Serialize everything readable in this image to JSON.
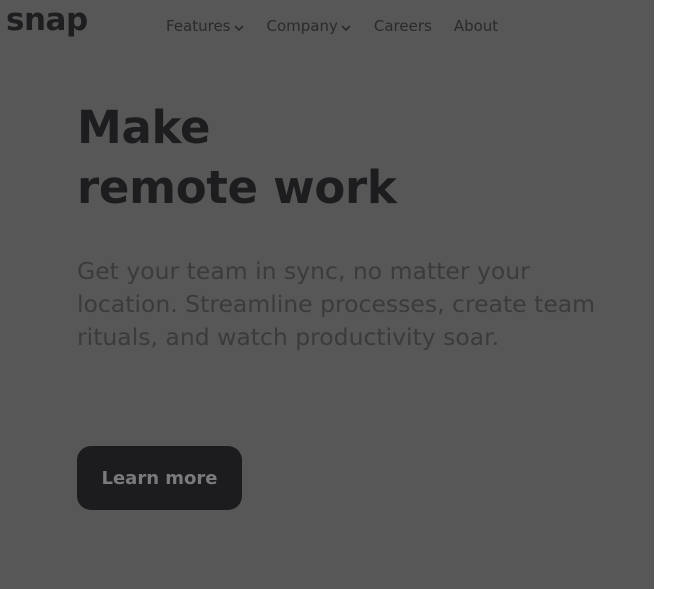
{
  "brand": {
    "logo_text": "snap"
  },
  "nav": {
    "items": [
      {
        "label": "Features",
        "has_dropdown": true
      },
      {
        "label": "Company",
        "has_dropdown": true
      },
      {
        "label": "Careers",
        "has_dropdown": false
      },
      {
        "label": "About",
        "has_dropdown": false
      }
    ]
  },
  "hero": {
    "title_line1": "Make",
    "title_line2": "remote work",
    "description": "Get your team in sync, no matter your location. Streamline processes, create team rituals, and watch productivity soar.",
    "cta_label": "Learn more"
  },
  "colors": {
    "overlay_background": "#575757",
    "text_dark": "#1d1d1f",
    "button_background": "#1c1c1e"
  }
}
